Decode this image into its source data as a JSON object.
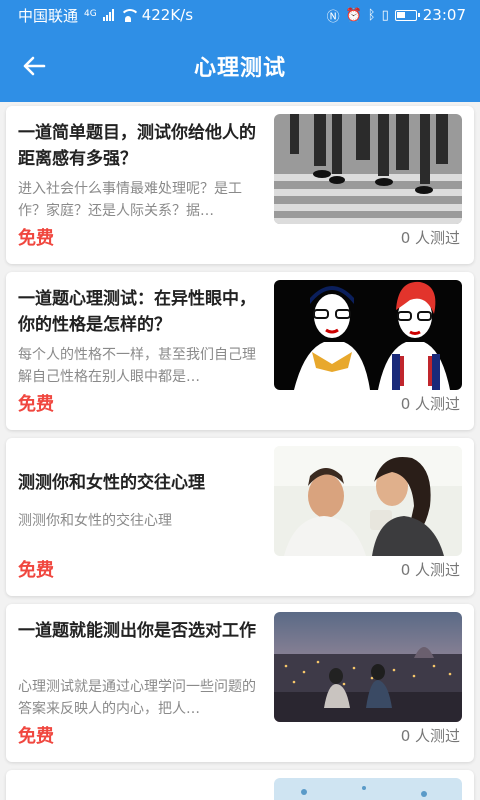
{
  "status_bar": {
    "carrier": "中国联通",
    "network": "4G",
    "speed": "422K/s",
    "time": "23:07"
  },
  "app_bar": {
    "title": "心理测试"
  },
  "tests": [
    {
      "title": "一道简单题目，测试你给他人的距离感有多强？",
      "desc": "进入社会什么事情最难处理呢？是工作？家庭？还是人际关系？据…",
      "price": "免费",
      "count": "0 人测过",
      "image": "crowd-crossing"
    },
    {
      "title": "一道题心理测试：在异性眼中，你的性格是怎样的？",
      "desc": "每个人的性格不一样，甚至我们自己理解自己性格在别人眼中都是…",
      "price": "免费",
      "count": "0 人测过",
      "image": "two-women-illustration"
    },
    {
      "title": "测测你和女性的交往心理",
      "desc": "测测你和女性的交往心理",
      "price": "免费",
      "count": "0 人测过",
      "image": "couple-laughing"
    },
    {
      "title": "一道题就能测出你是否选对工作",
      "desc": "心理测试就是通过心理学问一些问题的答案来反映人的内心，把人…",
      "price": "免费",
      "count": "0 人测过",
      "image": "couple-city-view"
    }
  ]
}
